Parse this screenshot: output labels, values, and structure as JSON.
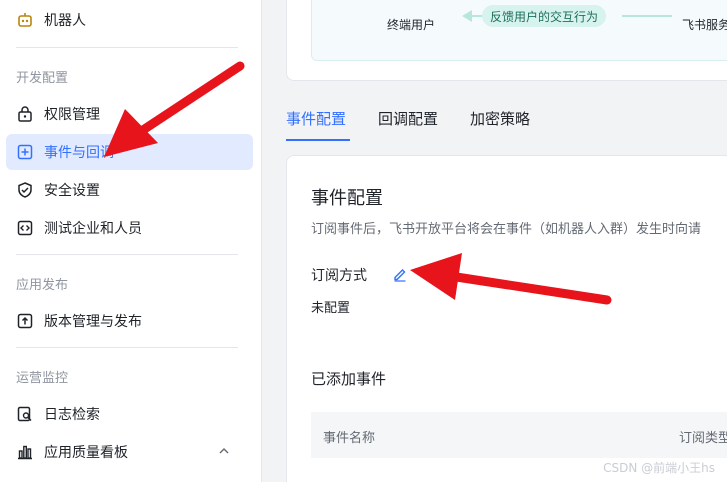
{
  "sidebar": {
    "robot_label": "机器人",
    "sections": [
      {
        "title": "开发配置",
        "items": [
          {
            "label": "权限管理",
            "icon": "lock-icon"
          },
          {
            "label": "事件与回调",
            "icon": "event-icon",
            "active": true
          },
          {
            "label": "安全设置",
            "icon": "shield-icon"
          },
          {
            "label": "测试企业和人员",
            "icon": "code-icon"
          }
        ]
      },
      {
        "title": "应用发布",
        "items": [
          {
            "label": "版本管理与发布",
            "icon": "upload-icon"
          }
        ]
      },
      {
        "title": "运营监控",
        "items": [
          {
            "label": "日志检索",
            "icon": "log-search-icon"
          },
          {
            "label": "应用质量看板",
            "icon": "bar-chart-icon"
          }
        ]
      }
    ]
  },
  "diagram": {
    "left_label": "终端用户",
    "flow_label": "反馈用户的交互行为",
    "right_label": "飞书服务"
  },
  "tabs": [
    {
      "label": "事件配置",
      "active": true
    },
    {
      "label": "回调配置"
    },
    {
      "label": "加密策略"
    }
  ],
  "event_config": {
    "title": "事件配置",
    "description": "订阅事件后，飞书开放平台将会在事件（如机器人入群）发生时向请",
    "subscription": {
      "label": "订阅方式",
      "value": "未配置"
    },
    "added_events_title": "已添加事件",
    "table_headers": [
      "事件名称",
      "订阅类型"
    ]
  },
  "watermark": "CSDN @前端小王hs",
  "colors": {
    "accent": "#3370ff",
    "active_bg": "#e1eaff",
    "annotation_red": "#e8141b"
  }
}
